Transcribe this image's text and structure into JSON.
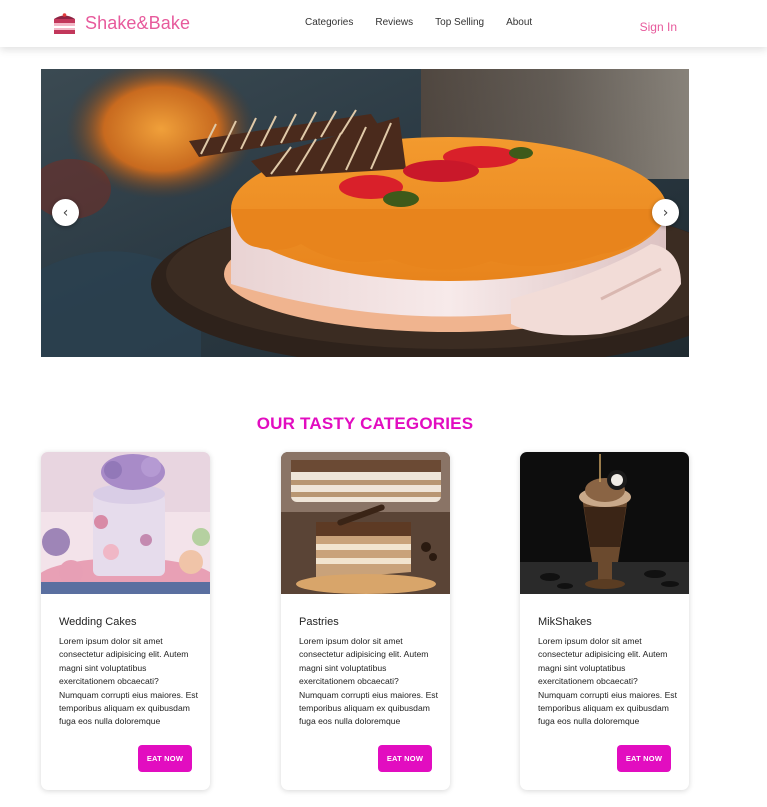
{
  "header": {
    "brand": "Shake&Bake",
    "nav": [
      "Categories",
      "Reviews",
      "Top Selling",
      "About"
    ],
    "signin": "Sign In"
  },
  "carousel": {
    "prev_icon": "chevron-left-icon",
    "next_icon": "chevron-right-icon",
    "prev_glyph": "‹",
    "next_glyph": "›"
  },
  "categories": {
    "title": "OUR TASTY CATEGORIES",
    "cards": [
      {
        "title": "Wedding Cakes",
        "text": "Lorem ipsum dolor sit amet consectetur adipisicing elit. Autem magni sint voluptatibus exercitationem obcaecati? Numquam corrupti eius maiores. Est temporibus aliquam ex quibusdam fuga eos nulla doloremque",
        "button": "EAT NOW"
      },
      {
        "title": "Pastries",
        "text": "Lorem ipsum dolor sit amet consectetur adipisicing elit. Autem magni sint voluptatibus exercitationem obcaecati? Numquam corrupti eius maiores. Est temporibus aliquam ex quibusdam fuga eos nulla doloremque",
        "button": "EAT NOW"
      },
      {
        "title": "MikShakes",
        "text": "Lorem ipsum dolor sit amet consectetur adipisicing elit. Autem magni sint voluptatibus exercitationem obcaecati? Numquam corrupti eius maiores. Est temporibus aliquam ex quibusdam fuga eos nulla doloremque",
        "button": "EAT NOW"
      }
    ]
  },
  "colors": {
    "brand_pink": "#e75a9c",
    "accent_magenta": "#e20dc0"
  }
}
